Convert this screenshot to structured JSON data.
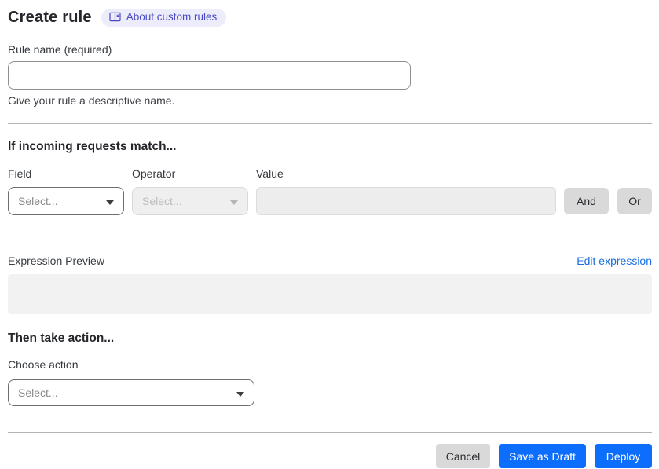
{
  "page": {
    "title": "Create rule",
    "about_link": "About custom rules"
  },
  "rule_name": {
    "label": "Rule name (required)",
    "value": "",
    "placeholder": "",
    "helper": "Give your rule a descriptive name."
  },
  "match_section": {
    "heading": "If incoming requests match...",
    "field": {
      "label": "Field",
      "value": "Select..."
    },
    "operator": {
      "label": "Operator",
      "value": "Select...",
      "disabled": true
    },
    "value": {
      "label": "Value",
      "value": "",
      "disabled": true
    },
    "and_button": "And",
    "or_button": "Or",
    "expression_preview_label": "Expression Preview",
    "edit_expression_link": "Edit expression",
    "expression_value": ""
  },
  "action_section": {
    "heading": "Then take action...",
    "choose_action_label": "Choose action",
    "action_value": "Select..."
  },
  "footer": {
    "cancel": "Cancel",
    "save_draft": "Save as Draft",
    "deploy": "Deploy"
  },
  "colors": {
    "primary_blue": "#0d6efd",
    "link_blue": "#1a6fe0",
    "badge_bg": "#ececfa",
    "badge_text": "#4949c7",
    "gray_button_bg": "#d9d9d9",
    "disabled_bg": "#efefef",
    "preview_bg": "#f2f2f2",
    "divider": "#b3b3b3"
  }
}
